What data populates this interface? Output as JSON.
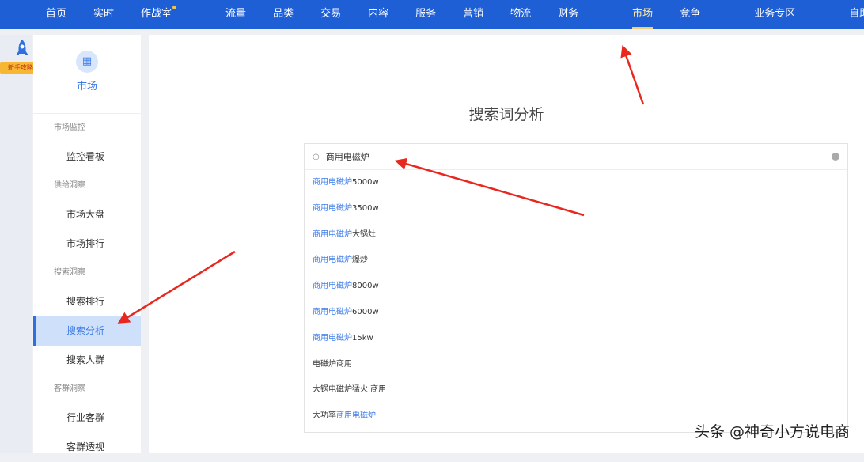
{
  "nav": {
    "items": [
      "首页",
      "实时",
      "作战室",
      "流量",
      "品类",
      "交易",
      "内容",
      "服务",
      "营销",
      "物流",
      "财务",
      "市场",
      "竞争",
      "业务专区",
      "自助分析"
    ],
    "active": "市场"
  },
  "rail": {
    "badge": "新手攻略"
  },
  "sidebar": {
    "module": "市场",
    "groups": [
      {
        "label": "市场监控",
        "items": [
          "监控看板"
        ]
      },
      {
        "label": "供给洞察",
        "items": [
          "市场大盘",
          "市场排行"
        ]
      },
      {
        "label": "搜索洞察",
        "items": [
          "搜索排行",
          "搜索分析",
          "搜索人群"
        ]
      },
      {
        "label": "客群洞察",
        "items": [
          "行业客群",
          "客群透视"
        ]
      }
    ],
    "active": "搜索分析"
  },
  "main": {
    "title": "搜索词分析",
    "search_value": "商用电磁炉",
    "suggestions": [
      {
        "pre": "",
        "hl": "商用电磁炉",
        "post": "5000w"
      },
      {
        "pre": "",
        "hl": "商用电磁炉",
        "post": "3500w"
      },
      {
        "pre": "",
        "hl": "商用电磁炉",
        "post": "大锅灶"
      },
      {
        "pre": "",
        "hl": "商用电磁炉",
        "post": "爆炒"
      },
      {
        "pre": "",
        "hl": "商用电磁炉",
        "post": "8000w"
      },
      {
        "pre": "",
        "hl": "商用电磁炉",
        "post": "6000w"
      },
      {
        "pre": "",
        "hl": "商用电磁炉",
        "post": "15kw"
      },
      {
        "pre": "电磁炉商用",
        "hl": "",
        "post": ""
      },
      {
        "pre": "大锅电磁炉猛火 商用",
        "hl": "",
        "post": ""
      },
      {
        "pre": "大功率",
        "hl": "商用电磁炉",
        "post": ""
      }
    ]
  },
  "watermark": "头条 @神奇小方说电商",
  "colors": {
    "nav": "#1f5fd6",
    "accent": "#3b7ae8",
    "arrow": "#e8281e"
  }
}
